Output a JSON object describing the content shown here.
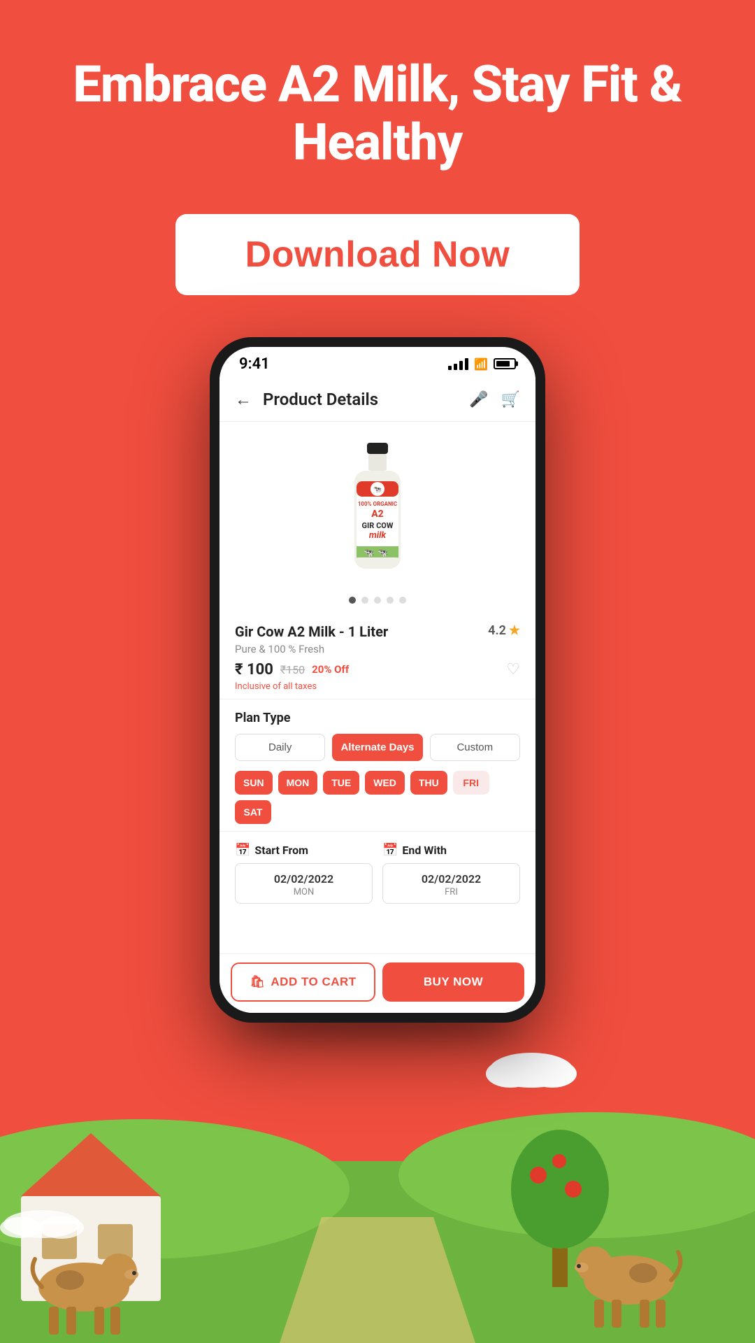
{
  "hero": {
    "title": "Embrace A2 Milk, Stay Fit & Healthy",
    "download_btn": "Download Now"
  },
  "status_bar": {
    "time": "9:41",
    "signal": "signal",
    "wifi": "wifi",
    "battery": "battery"
  },
  "app_header": {
    "title": "Product Details",
    "back": "←",
    "mic_icon": "mic",
    "cart_icon": "cart"
  },
  "product": {
    "name": "Gir Cow A2 Milk - 1 Liter",
    "description": "Pure & 100 % Fresh",
    "rating": "4.2",
    "price_current": "₹ 100",
    "price_original": "₹150",
    "discount": "20% Off",
    "tax_note": "Inclusive of all taxes",
    "image_alt": "A2 Gir Cow Milk Bottle"
  },
  "plan": {
    "section_title": "Plan Type",
    "buttons": [
      {
        "label": "Daily",
        "active": false
      },
      {
        "label": "Alternate Days",
        "active": true
      },
      {
        "label": "Custom",
        "active": false
      }
    ],
    "days": [
      {
        "label": "SUN",
        "active": true
      },
      {
        "label": "MON",
        "active": true
      },
      {
        "label": "TUE",
        "active": true
      },
      {
        "label": "WED",
        "active": true
      },
      {
        "label": "THU",
        "active": true
      },
      {
        "label": "FRI",
        "active": false
      },
      {
        "label": "SAT",
        "active": true
      }
    ]
  },
  "dates": {
    "start_label": "Start From",
    "end_label": "End With",
    "start_value": "02/02/2022",
    "start_day": "MON",
    "end_value": "02/02/2022",
    "end_day": "FRI"
  },
  "actions": {
    "add_to_cart": "ADD TO CART",
    "buy_now": "BUY NOW"
  }
}
